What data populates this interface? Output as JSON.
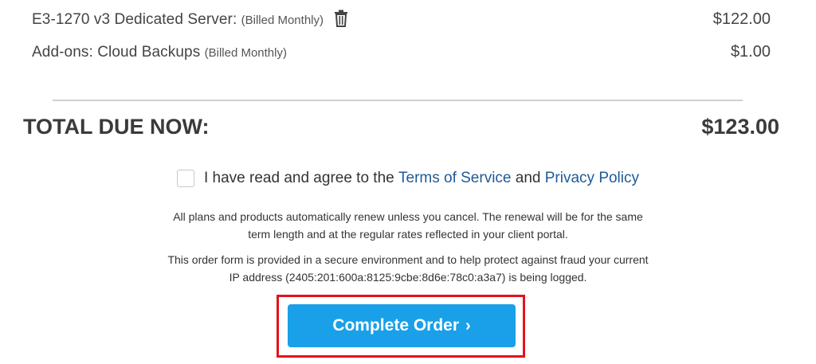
{
  "line_items": [
    {
      "name": "E3-1270 v3 Dedicated Server:",
      "billing": "(Billed Monthly)",
      "price": "$122.00",
      "has_delete_icon": true
    },
    {
      "name": "Add-ons: Cloud Backups",
      "billing": "(Billed Monthly)",
      "price": "$1.00",
      "has_delete_icon": false
    }
  ],
  "total": {
    "label": "TOTAL DUE NOW:",
    "amount": "$123.00"
  },
  "agreement": {
    "prefix": "I have read and agree to the",
    "tos_link": "Terms of Service",
    "conjunction": "and",
    "privacy_link": "Privacy Policy",
    "checked": false
  },
  "notices": {
    "renewal_line1": "All plans and products automatically renew unless you cancel. The renewal will be for the same",
    "renewal_line2": "term length and at the regular rates reflected in your client portal.",
    "security_line1": "This order form is provided in a secure environment and to help protect against fraud your current",
    "security_line2": "IP address (2405:201:600a:8125:9cbe:8d6e:78c0:a3a7) is being logged."
  },
  "submit": {
    "label": "Complete Order",
    "chevron": "›"
  },
  "colors": {
    "accent_button": "#1aa0e8",
    "link": "#1f5a96",
    "highlight": "#e5121b"
  },
  "icons": {
    "delete": "trash-icon",
    "chevron": "chevron-right-icon"
  }
}
